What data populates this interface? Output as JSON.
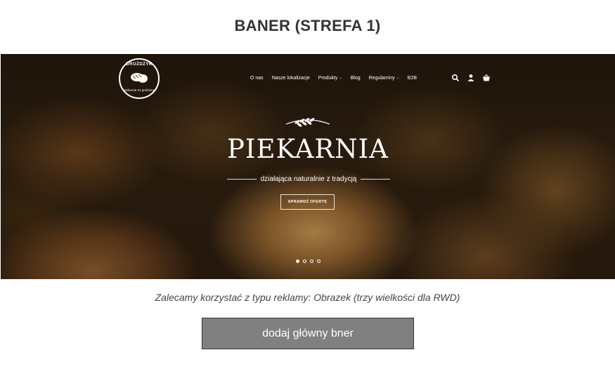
{
  "section_title": "BANER (STREFA 1)",
  "banner": {
    "logo": {
      "name": "DROŻDŻYK",
      "subtitle": "piekarnia 24 godzinna"
    },
    "nav": [
      {
        "label": "O nas",
        "has_dropdown": false
      },
      {
        "label": "Nasze lokalizacje",
        "has_dropdown": false
      },
      {
        "label": "Produkty",
        "has_dropdown": true
      },
      {
        "label": "Blog",
        "has_dropdown": false
      },
      {
        "label": "Regulaminy",
        "has_dropdown": true
      },
      {
        "label": "B2B",
        "has_dropdown": false
      }
    ],
    "nav_icons": [
      "search-icon",
      "user-icon",
      "basket-icon"
    ],
    "dropdown_caret": "⌄",
    "hero_title": "PIEKARNIA",
    "hero_subtitle": "działająca naturalnie z tradycją",
    "cta_label": "SPRAWDŹ OFERTĘ",
    "slides": {
      "count": 4,
      "active_index": 0
    }
  },
  "note": "Zalecamy korzystać z typu reklamy: Obrazek (trzy wielkości dla RWD)",
  "add_button_label": "dodaj główny bner",
  "colors": {
    "button_bg": "#808080",
    "title_text": "#333333",
    "banner_text": "#ffffff"
  }
}
